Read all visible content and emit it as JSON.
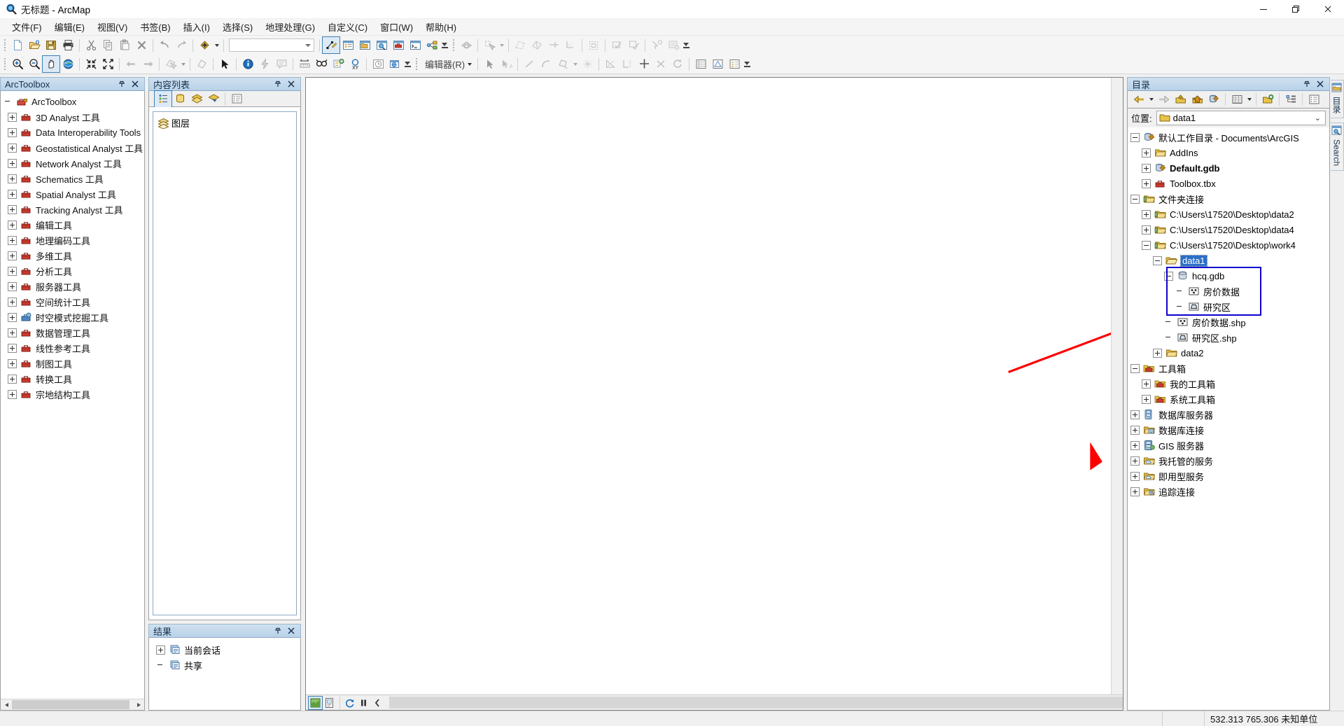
{
  "window": {
    "title_document": "无标题",
    "title_app": "ArcMap",
    "title_sep": " - ",
    "minimize": "—",
    "maximize": "❐",
    "close": "✕"
  },
  "menubar": {
    "items": [
      {
        "label": "文件(F)",
        "name": "menu-file"
      },
      {
        "label": "编辑(E)",
        "name": "menu-edit"
      },
      {
        "label": "视图(V)",
        "name": "menu-view"
      },
      {
        "label": "书签(B)",
        "name": "menu-bookmarks"
      },
      {
        "label": "插入(I)",
        "name": "menu-insert"
      },
      {
        "label": "选择(S)",
        "name": "menu-selection"
      },
      {
        "label": "地理处理(G)",
        "name": "menu-geoprocessing"
      },
      {
        "label": "自定义(C)",
        "name": "menu-customize"
      },
      {
        "label": "窗口(W)",
        "name": "menu-window"
      },
      {
        "label": "帮助(H)",
        "name": "menu-help"
      }
    ]
  },
  "toolbars": {
    "standard": [
      "new-icon",
      "open-icon",
      "save-icon",
      "print-icon",
      "cut-icon",
      "copy-icon",
      "paste-icon",
      "delete-icon",
      "undo-icon",
      "redo-icon",
      "add-data-icon"
    ],
    "scale_value": "",
    "editor_label": "编辑器(R)"
  },
  "arctoolbox": {
    "panel_title": "ArcToolbox",
    "root": "ArcToolbox",
    "items": [
      {
        "label": "3D Analyst 工具",
        "icon": "toolbox-icon"
      },
      {
        "label": "Data Interoperability Tools",
        "icon": "toolbox-icon"
      },
      {
        "label": "Geostatistical Analyst 工具",
        "icon": "toolbox-icon"
      },
      {
        "label": "Network Analyst 工具",
        "icon": "toolbox-icon"
      },
      {
        "label": "Schematics 工具",
        "icon": "toolbox-icon"
      },
      {
        "label": "Spatial Analyst 工具",
        "icon": "toolbox-icon"
      },
      {
        "label": "Tracking Analyst 工具",
        "icon": "toolbox-icon"
      },
      {
        "label": "编辑工具",
        "icon": "toolbox-icon"
      },
      {
        "label": "地理编码工具",
        "icon": "toolbox-icon"
      },
      {
        "label": "多维工具",
        "icon": "toolbox-icon"
      },
      {
        "label": "分析工具",
        "icon": "toolbox-icon"
      },
      {
        "label": "服务器工具",
        "icon": "toolbox-icon"
      },
      {
        "label": "空间统计工具",
        "icon": "toolbox-icon"
      },
      {
        "label": "时空模式挖掘工具",
        "icon": "toolbox-blue-icon"
      },
      {
        "label": "数据管理工具",
        "icon": "toolbox-icon"
      },
      {
        "label": "线性参考工具",
        "icon": "toolbox-icon"
      },
      {
        "label": "制图工具",
        "icon": "toolbox-icon"
      },
      {
        "label": "转换工具",
        "icon": "toolbox-icon"
      },
      {
        "label": "宗地结构工具",
        "icon": "toolbox-icon"
      }
    ]
  },
  "toc": {
    "panel_title": "内容列表",
    "tabs": [
      "list-by-drawing-order",
      "list-by-source",
      "list-by-visibility",
      "list-by-selection",
      "options"
    ],
    "root_layer": "图层"
  },
  "results": {
    "panel_title": "结果",
    "items": [
      {
        "label": "当前会话",
        "expandable": true
      },
      {
        "label": "共享",
        "expandable": false
      }
    ]
  },
  "catalog": {
    "panel_title": "目录",
    "location_label": "位置:",
    "location_value": "data1",
    "tree": [
      {
        "depth": 0,
        "label": "默认工作目录 - Documents\\ArcGIS",
        "icon": "home-gdb-icon",
        "exp": "minus"
      },
      {
        "depth": 1,
        "label": "AddIns",
        "icon": "folder-icon",
        "exp": "plus"
      },
      {
        "depth": 1,
        "label": "Default.gdb",
        "icon": "home-gdb-icon",
        "exp": "plus",
        "bold": true
      },
      {
        "depth": 1,
        "label": "Toolbox.tbx",
        "icon": "toolbox-icon",
        "exp": "plus"
      },
      {
        "depth": 0,
        "label": "文件夹连接",
        "icon": "folder-connection-icon",
        "exp": "minus"
      },
      {
        "depth": 1,
        "label": "C:\\Users\\17520\\Desktop\\data2",
        "icon": "folder-connection-icon",
        "exp": "plus"
      },
      {
        "depth": 1,
        "label": "C:\\Users\\17520\\Desktop\\data4",
        "icon": "folder-connection-icon",
        "exp": "plus"
      },
      {
        "depth": 1,
        "label": "C:\\Users\\17520\\Desktop\\work4",
        "icon": "folder-connection-icon",
        "exp": "minus"
      },
      {
        "depth": 2,
        "label": "data1",
        "icon": "folder-open-icon",
        "exp": "minus",
        "selected": true
      },
      {
        "depth": 3,
        "label": "hcq.gdb",
        "icon": "gdb-icon",
        "exp": "minus"
      },
      {
        "depth": 4,
        "label": "房价数据",
        "icon": "point-feature-icon",
        "exp": "none"
      },
      {
        "depth": 4,
        "label": "研究区",
        "icon": "polygon-feature-icon",
        "exp": "none"
      },
      {
        "depth": 3,
        "label": "房价数据.shp",
        "icon": "point-feature-icon",
        "exp": "none"
      },
      {
        "depth": 3,
        "label": "研究区.shp",
        "icon": "polygon-feature-icon",
        "exp": "none"
      },
      {
        "depth": 2,
        "label": "data2",
        "icon": "folder-icon",
        "exp": "plus"
      },
      {
        "depth": 0,
        "label": "工具箱",
        "icon": "toolbox-folder-icon",
        "exp": "minus"
      },
      {
        "depth": 1,
        "label": "我的工具箱",
        "icon": "toolbox-folder-icon",
        "exp": "plus"
      },
      {
        "depth": 1,
        "label": "系统工具箱",
        "icon": "toolbox-folder-icon",
        "exp": "plus"
      },
      {
        "depth": 0,
        "label": "数据库服务器",
        "icon": "db-server-icon",
        "exp": "plus"
      },
      {
        "depth": 0,
        "label": "数据库连接",
        "icon": "db-connection-icon",
        "exp": "plus"
      },
      {
        "depth": 0,
        "label": "GIS 服务器",
        "icon": "gis-server-icon",
        "exp": "plus"
      },
      {
        "depth": 0,
        "label": "我托管的服务",
        "icon": "cloud-service-icon",
        "exp": "plus"
      },
      {
        "depth": 0,
        "label": "即用型服务",
        "icon": "cloud-service-icon",
        "exp": "plus"
      },
      {
        "depth": 0,
        "label": "追踪连接",
        "icon": "tracking-connection-icon",
        "exp": "plus"
      }
    ]
  },
  "side_tabs": [
    {
      "label": "目录",
      "name": "vtab-catalog",
      "icon": "catalog-icon"
    },
    {
      "label": "Search",
      "name": "vtab-search",
      "icon": "search-icon"
    }
  ],
  "map": {
    "bottom_buttons": [
      "data-view-icon",
      "layout-view-icon",
      "refresh-icon",
      "pause-icon",
      "collapse-icon"
    ]
  },
  "statusbar": {
    "coords": "532.313  765.306  未知单位"
  },
  "annotation": {
    "arrow_color": "#ff0000",
    "box_color": "#1000d0"
  }
}
